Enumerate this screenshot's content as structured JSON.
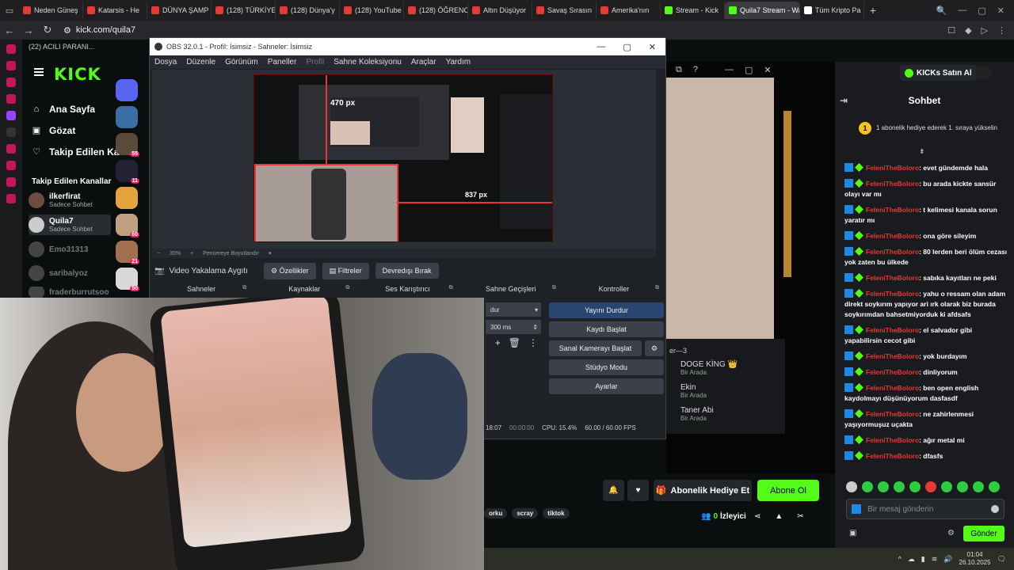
{
  "browser": {
    "tabs": [
      {
        "label": "Neden Güneş",
        "color": "#e53935"
      },
      {
        "label": "Katarsis - He",
        "color": "#e53935"
      },
      {
        "label": "DÜNYA ŞAMP",
        "color": "#e53935"
      },
      {
        "label": "(128) TÜRKİYE",
        "color": "#e53935"
      },
      {
        "label": "(128) Dünya'y",
        "color": "#e53935"
      },
      {
        "label": "(128) YouTube",
        "color": "#e53935"
      },
      {
        "label": "(128) ÖĞRENCİ",
        "color": "#e53935"
      },
      {
        "label": "Altın Düşüyor",
        "color": "#e53935"
      },
      {
        "label": "Savaş Sırasın",
        "color": "#e53935"
      },
      {
        "label": "Amerika'nın",
        "color": "#e53935"
      },
      {
        "label": "Stream - Kick",
        "color": "#53fc18"
      },
      {
        "label": "Quila7 Stream - Watch L",
        "color": "#53fc18",
        "active": true
      },
      {
        "label": "Tüm Kripto Pa",
        "color": "#ffffff"
      }
    ],
    "url": "kick.com/quila7",
    "notice": "(22) ACILI PARANI..."
  },
  "kick": {
    "logo": "KICK",
    "nav": [
      {
        "label": "Ana Sayfa",
        "icon": "home-icon"
      },
      {
        "label": "Gözat",
        "icon": "browse-icon"
      },
      {
        "label": "Takip Edilen Ka",
        "icon": "heart-icon"
      }
    ],
    "following_title": "Takip Edilen Kanallar",
    "channels": [
      {
        "name": "ilkerfirat",
        "status": "Sadece Sohbet"
      },
      {
        "name": "Quila7",
        "status": "Sadece Sohbet"
      },
      {
        "name": "Emo31313",
        "status": ""
      },
      {
        "name": "saribalyoz",
        "status": ""
      },
      {
        "name": "fraderburrutsoo",
        "status": ""
      }
    ],
    "social_badges": [
      "55",
      "11",
      "60",
      "21",
      "50"
    ]
  },
  "obs": {
    "title": "OBS 32.0.1 - Profil: İsimsiz - Sahneler: İsimsiz",
    "menu": [
      "Dosya",
      "Düzenle",
      "Görünüm",
      "Paneller",
      "Profil",
      "Sahne Koleksiyonu",
      "Araçlar",
      "Yardım"
    ],
    "zoom": "35%",
    "zoom_label": "Pencereye Boyutlandır",
    "source_name": "Video Yakalama Aygıtı",
    "source_buttons": [
      "Özellikler",
      "Filtreler",
      "Devredışı Bırak"
    ],
    "docks": [
      "Sahneler",
      "Kaynaklar",
      "Ses Karıştırıcı",
      "Sahne Geçişleri",
      "Kontroller"
    ],
    "transition_value": "dur",
    "transition_duration": "300 ms",
    "controls": [
      "Yayını Durdur",
      "Kaydı Başlat",
      "Sanal Kamerayı Başlat",
      "Stüdyo Modu",
      "Ayarlar"
    ],
    "status": {
      "live": "18:07",
      "rec": "00:00:00",
      "cpu": "CPU: 15.4%",
      "fps": "60.00 / 60.00 FPS"
    },
    "nested_labels": {
      "px1": "470 px",
      "px2": "837 px"
    }
  },
  "stream": {
    "viewers_header": "er—3",
    "viewers": [
      {
        "name": "DOGE KİNG 👑",
        "status": "Bir Arada"
      },
      {
        "name": "Ekin",
        "status": "Bir Arada"
      },
      {
        "name": "Taner Abi",
        "status": "Bir Arada"
      }
    ],
    "gift_label": "Abonelik Hediye Et",
    "follow_label": "Abone Ol",
    "viewer_count": "0",
    "viewer_label": "İzleyici",
    "tags": [
      "orku",
      "scray",
      "tiktok"
    ]
  },
  "chat": {
    "kicks_label": "KICKs Satın Al",
    "title": "Sohbet",
    "pinned_rank": "1",
    "pinned_text": "1 abonelik hediye ederek 1. sıraya yükselin",
    "messages": [
      {
        "user": "FeleniTheBoloro",
        "text": "evet gündemde hala"
      },
      {
        "user": "FeleniTheBoloro",
        "text": "bu arada kickte sansür olayı var mı"
      },
      {
        "user": "FeleniTheBoloro",
        "text": "t kelimesi kanala sorun yaratır mı"
      },
      {
        "user": "FeleniTheBoloro",
        "text": "ona göre sileyim"
      },
      {
        "user": "FeleniTheBoloro",
        "text": "80 lerden beri ölüm cezası yok zaten bu ülkede"
      },
      {
        "user": "FeleniTheBoloro",
        "text": "sabıka kayıtları ne peki"
      },
      {
        "user": "FeleniTheBoloro",
        "text": "yahu o ressam olan adam direkt soykırım yapıyor ari ırk olarak biz burada soykırımdan bahsetmiyorduk ki afdsafs"
      },
      {
        "user": "FeleniTheBoloro",
        "text": "el salvador gibi yapabilirsin cecot gibi"
      },
      {
        "user": "FeleniTheBoloro",
        "text": "yok burdayım"
      },
      {
        "user": "FeleniTheBoloro",
        "text": "dinliyorum"
      },
      {
        "user": "FeleniTheBoloro",
        "text": "ben open english kaydolmayı düşünüyorum dasfasdf"
      },
      {
        "user": "FeleniTheBoloro",
        "text": "ne zahirlenmesi yaşıyormuşuz uçakta"
      },
      {
        "user": "FeleniTheBoloro",
        "text": "ağır metal mi"
      },
      {
        "user": "FeleniTheBoloro",
        "text": "dfasfs"
      }
    ],
    "input_placeholder": "Bir mesaj gönderin",
    "send_label": "Gönder"
  },
  "taskbar": {
    "time": "01:04",
    "date": "26.10.2025"
  }
}
